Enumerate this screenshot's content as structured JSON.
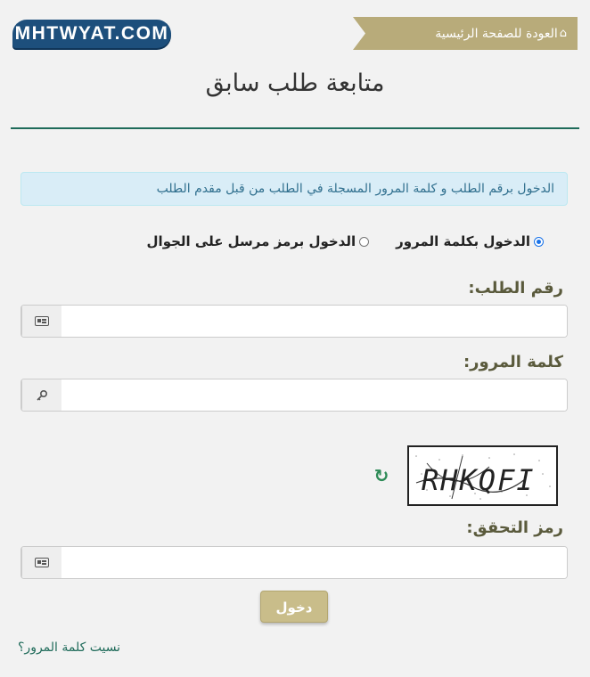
{
  "logo": {
    "text": "MHTWYAT.COM"
  },
  "header": {
    "back_label": "العودة للصفحة الرئيسية",
    "back_icon": "home-icon"
  },
  "page": {
    "title": "متابعة طلب سابق"
  },
  "info": {
    "text": "الدخول برقم الطلب و كلمة المرور المسجلة في الطلب من قبل مقدم الطلب"
  },
  "login_modes": [
    {
      "label": "الدخول بكلمة المرور",
      "checked": true
    },
    {
      "label": "الدخول برمز مرسل على الجوال",
      "checked": false
    }
  ],
  "fields": {
    "request_number": {
      "label": "رقم الطلب:",
      "value": "",
      "icon": "id-card-icon"
    },
    "password": {
      "label": "كلمة المرور:",
      "value": "",
      "icon": "key-icon"
    },
    "captcha": {
      "label": "رمز التحقق:",
      "value": "",
      "icon": "id-card-icon",
      "image_text": "RHKQFI"
    }
  },
  "actions": {
    "submit_label": "دخول",
    "forgot_label": "نسيت كلمة المرور؟"
  },
  "colors": {
    "brand": "#1d4f7c",
    "ribbon": "#b8ab7a",
    "accent": "#1f6b5a",
    "button": "#c9bd8a"
  }
}
